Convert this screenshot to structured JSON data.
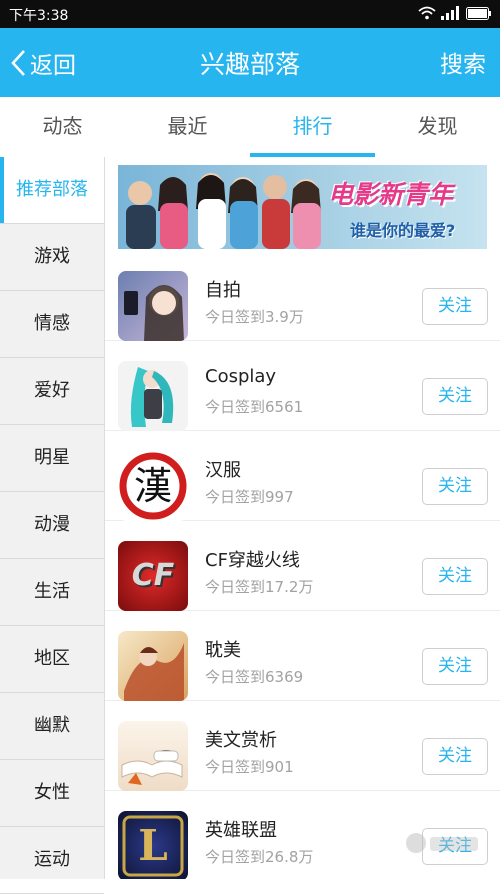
{
  "status_bar": {
    "time": "下午3:38"
  },
  "nav": {
    "back_label": "返回",
    "title": "兴趣部落",
    "search_label": "搜索"
  },
  "tabs": [
    {
      "label": "动态",
      "active": false
    },
    {
      "label": "最近",
      "active": false
    },
    {
      "label": "排行",
      "active": true
    },
    {
      "label": "发现",
      "active": false
    }
  ],
  "sidebar": {
    "items": [
      {
        "label": "推荐部落",
        "active": true
      },
      {
        "label": "游戏"
      },
      {
        "label": "情感"
      },
      {
        "label": "爱好"
      },
      {
        "label": "明星"
      },
      {
        "label": "动漫"
      },
      {
        "label": "生活"
      },
      {
        "label": "地区"
      },
      {
        "label": "幽默"
      },
      {
        "label": "女性"
      },
      {
        "label": "运动"
      }
    ]
  },
  "banner": {
    "title": "电影新青年",
    "subtitle": "谁是你的最爱?"
  },
  "tribes": [
    {
      "name": "自拍",
      "checkins": "今日签到3.9万",
      "follow_label": "关注",
      "thumb_icon": "selfie-thumb"
    },
    {
      "name": "Cosplay",
      "checkins": "今日签到6561",
      "follow_label": "关注",
      "thumb_icon": "cosplay-thumb"
    },
    {
      "name": "汉服",
      "checkins": "今日签到997",
      "follow_label": "关注",
      "thumb_icon": "hanfu-thumb",
      "thumb_text": "漢"
    },
    {
      "name": "CF穿越火线",
      "checkins": "今日签到17.2万",
      "follow_label": "关注",
      "thumb_icon": "crossfire-thumb",
      "thumb_text": "CF"
    },
    {
      "name": "耽美",
      "checkins": "今日签到6369",
      "follow_label": "关注",
      "thumb_icon": "danmei-thumb"
    },
    {
      "name": "美文赏析",
      "checkins": "今日签到901",
      "follow_label": "关注",
      "thumb_icon": "essay-thumb"
    },
    {
      "name": "英雄联盟",
      "checkins": "今日签到26.8万",
      "follow_label": "关注",
      "thumb_icon": "lol-thumb",
      "thumb_text": "L"
    }
  ],
  "colors": {
    "accent": "#26b5ef",
    "status_bar": "#0d0d0d"
  }
}
